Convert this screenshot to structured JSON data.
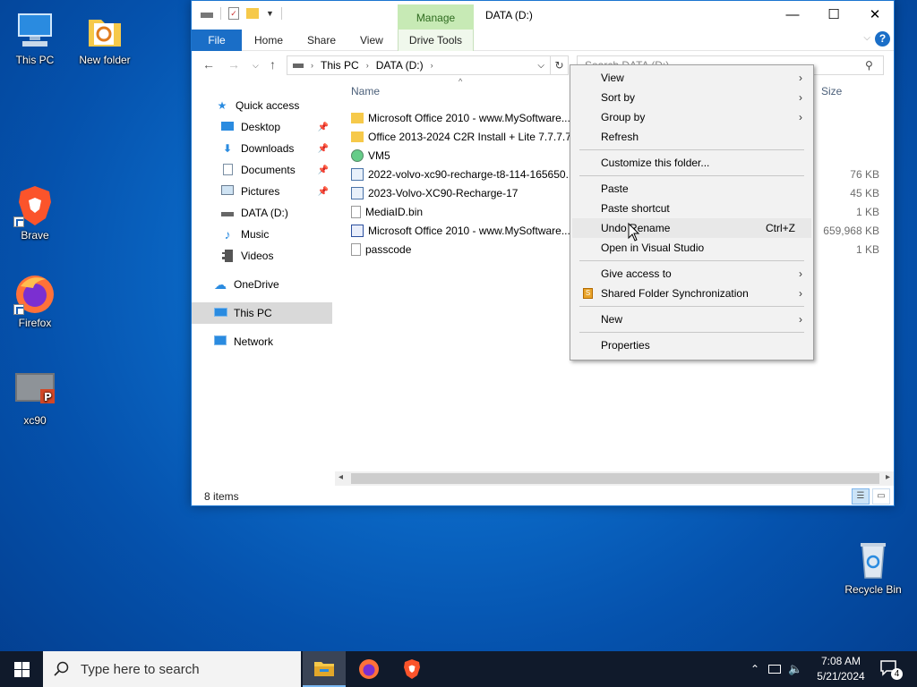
{
  "desktop": {
    "icons": [
      {
        "label": "This PC"
      },
      {
        "label": "New folder"
      },
      {
        "label": "Brave"
      },
      {
        "label": "Firefox"
      },
      {
        "label": "xc90"
      },
      {
        "label": "Recycle Bin"
      }
    ]
  },
  "window": {
    "title": "DATA (D:)",
    "context_tab": "Manage",
    "tabs": [
      "File",
      "Home",
      "Share",
      "View",
      "Drive Tools"
    ],
    "address": {
      "segments": [
        "This PC",
        "DATA (D:)"
      ]
    },
    "search": {
      "placeholder": "Search DATA (D:)"
    },
    "nav": {
      "items": [
        {
          "label": "Quick access"
        },
        {
          "label": "Desktop"
        },
        {
          "label": "Downloads"
        },
        {
          "label": "Documents"
        },
        {
          "label": "Pictures"
        },
        {
          "label": "DATA (D:)"
        },
        {
          "label": "Music"
        },
        {
          "label": "Videos"
        },
        {
          "label": "OneDrive"
        },
        {
          "label": "This PC"
        },
        {
          "label": "Network"
        }
      ]
    },
    "columns": {
      "name": "Name",
      "size": "Size"
    },
    "files": [
      {
        "name": "Microsoft Office 2010 - www.MySoftware...",
        "size": ""
      },
      {
        "name": "Office 2013-2024 C2R Install + Lite 7.7.7.7...",
        "size": ""
      },
      {
        "name": "VM5",
        "size": ""
      },
      {
        "name": "2022-volvo-xc90-recharge-t8-114-165650...",
        "size": "76 KB"
      },
      {
        "name": "2023-Volvo-XC90-Recharge-17",
        "size": "45 KB"
      },
      {
        "name": "MediaID.bin",
        "size": "1 KB"
      },
      {
        "name": "Microsoft Office 2010 - www.MySoftware...",
        "size": "659,968 KB"
      },
      {
        "name": "passcode",
        "size": "1 KB"
      }
    ],
    "status": "8 items"
  },
  "context_menu": {
    "items": {
      "view": "View",
      "sort_by": "Sort by",
      "group_by": "Group by",
      "refresh": "Refresh",
      "customize": "Customize this folder...",
      "paste": "Paste",
      "paste_shortcut": "Paste shortcut",
      "undo_rename": "Undo Rename",
      "undo_shortcut": "Ctrl+Z",
      "open_vs": "Open in Visual Studio",
      "give_access": "Give access to",
      "shared_sync": "Shared Folder Synchronization",
      "new": "New",
      "properties": "Properties"
    }
  },
  "taskbar": {
    "search_placeholder": "Type here to search",
    "time": "7:08 AM",
    "date": "5/21/2024",
    "notification_count": "4"
  },
  "colors": {
    "accent": "#1a6ec7",
    "manage_tab": "#c7eab5",
    "taskbar": "#101a2b"
  }
}
